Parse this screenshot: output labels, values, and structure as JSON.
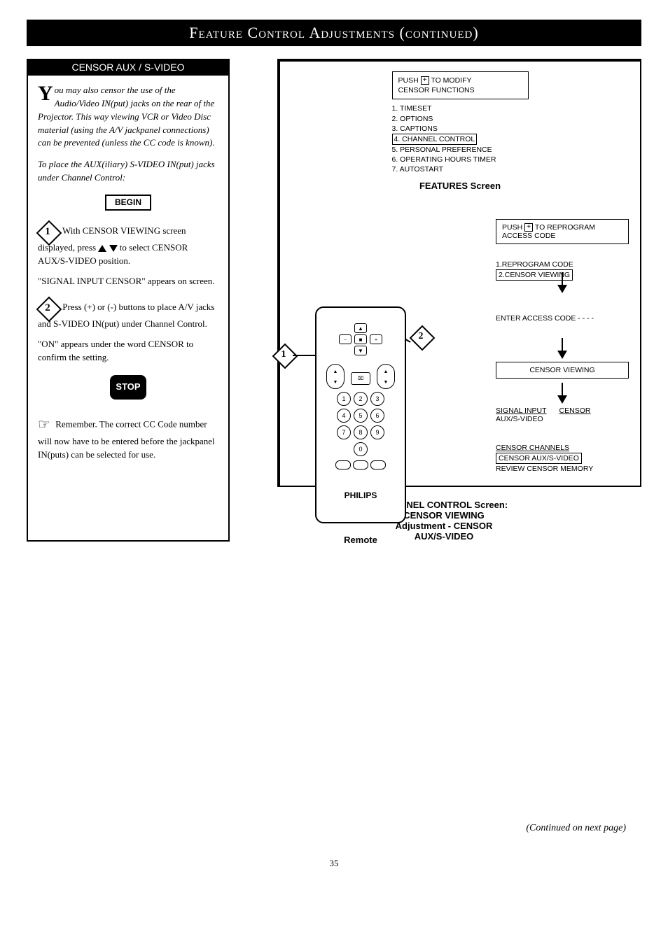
{
  "header": {
    "title": "Feature Control Adjustments (continued)"
  },
  "left": {
    "section_title": "CENSOR AUX / S-VIDEO",
    "intro_dropcap": "Y",
    "intro_text": "ou may also censor the use of the Audio/Video IN(put) jacks on the rear of the Projector. This way viewing VCR or Video Disc material (using the A/V jackpanel connections) can be prevented (unless the CC code is known).",
    "intro2": "To place the AUX(iliary) S-VIDEO IN(put) jacks under Channel Control:",
    "begin_label": "BEGIN",
    "step1_lead": "With CENSOR VIEWING screen displayed, press",
    "step1_tail": "to select CENSOR AUX/S-VIDEO position.",
    "step1_note": "\"SIGNAL INPUT CENSOR\" appears on screen.",
    "step2_lead": "Press (+) or (-) buttons to place A/V jacks and S-VIDEO IN(put) under Channel Control.",
    "step2_note": "\"ON\" appears under the word CENSOR to confirm the setting.",
    "stop_label": "STOP",
    "remember": "Remember. The correct CC Code number will now have to be entered before the jackpanel IN(puts) can be selected for use."
  },
  "right": {
    "osd_top_line1": "PUSH",
    "osd_top_line1b": "TO MODIFY",
    "osd_top_line2": "CENSOR FUNCTIONS",
    "features": {
      "i1": "1. TIMESET",
      "i2": "2. OPTIONS",
      "i3": "3. CAPTIONS",
      "i4": "4. CHANNEL CONTROL",
      "i5": "5. PERSONAL PREFERENCE",
      "i6": "6. OPERATING HOURS TIMER",
      "i7": "7. AUTOSTART"
    },
    "features_caption": "FEATURES Screen",
    "reprogram_box_l1a": "PUSH",
    "reprogram_box_l1b": "TO REPROGRAM",
    "reprogram_box_l2": "ACCESS CODE",
    "ccmenu": {
      "i1": "1.REPROGRAM CODE",
      "i2": "2.CENSOR VIEWING"
    },
    "enter_code": "ENTER ACCESS CODE - - - -",
    "censor_viewing_box": "CENSOR VIEWING",
    "signal_l1": "SIGNAL INPUT",
    "signal_l2": "AUX/S-VIDEO",
    "censor_col": "CENSOR",
    "bottom_menu": {
      "i1": "CENSOR CHANNELS",
      "i2": "CENSOR AUX/S-VIDEO",
      "i3": "REVIEW CENSOR MEMORY"
    },
    "final_caption_l1": "CHANNEL CONTROL Screen:",
    "final_caption_l2": "CENSOR VIEWING",
    "final_caption_l3": "Adjustment - CENSOR",
    "final_caption_l4": "AUX/S-VIDEO"
  },
  "remote": {
    "brand": "PHILIPS",
    "caption": "Remote",
    "numbers": [
      "1",
      "2",
      "3",
      "4",
      "5",
      "6",
      "7",
      "8",
      "9",
      "0"
    ]
  },
  "footer": {
    "continued": "(Continued on next page)",
    "page": "35"
  }
}
